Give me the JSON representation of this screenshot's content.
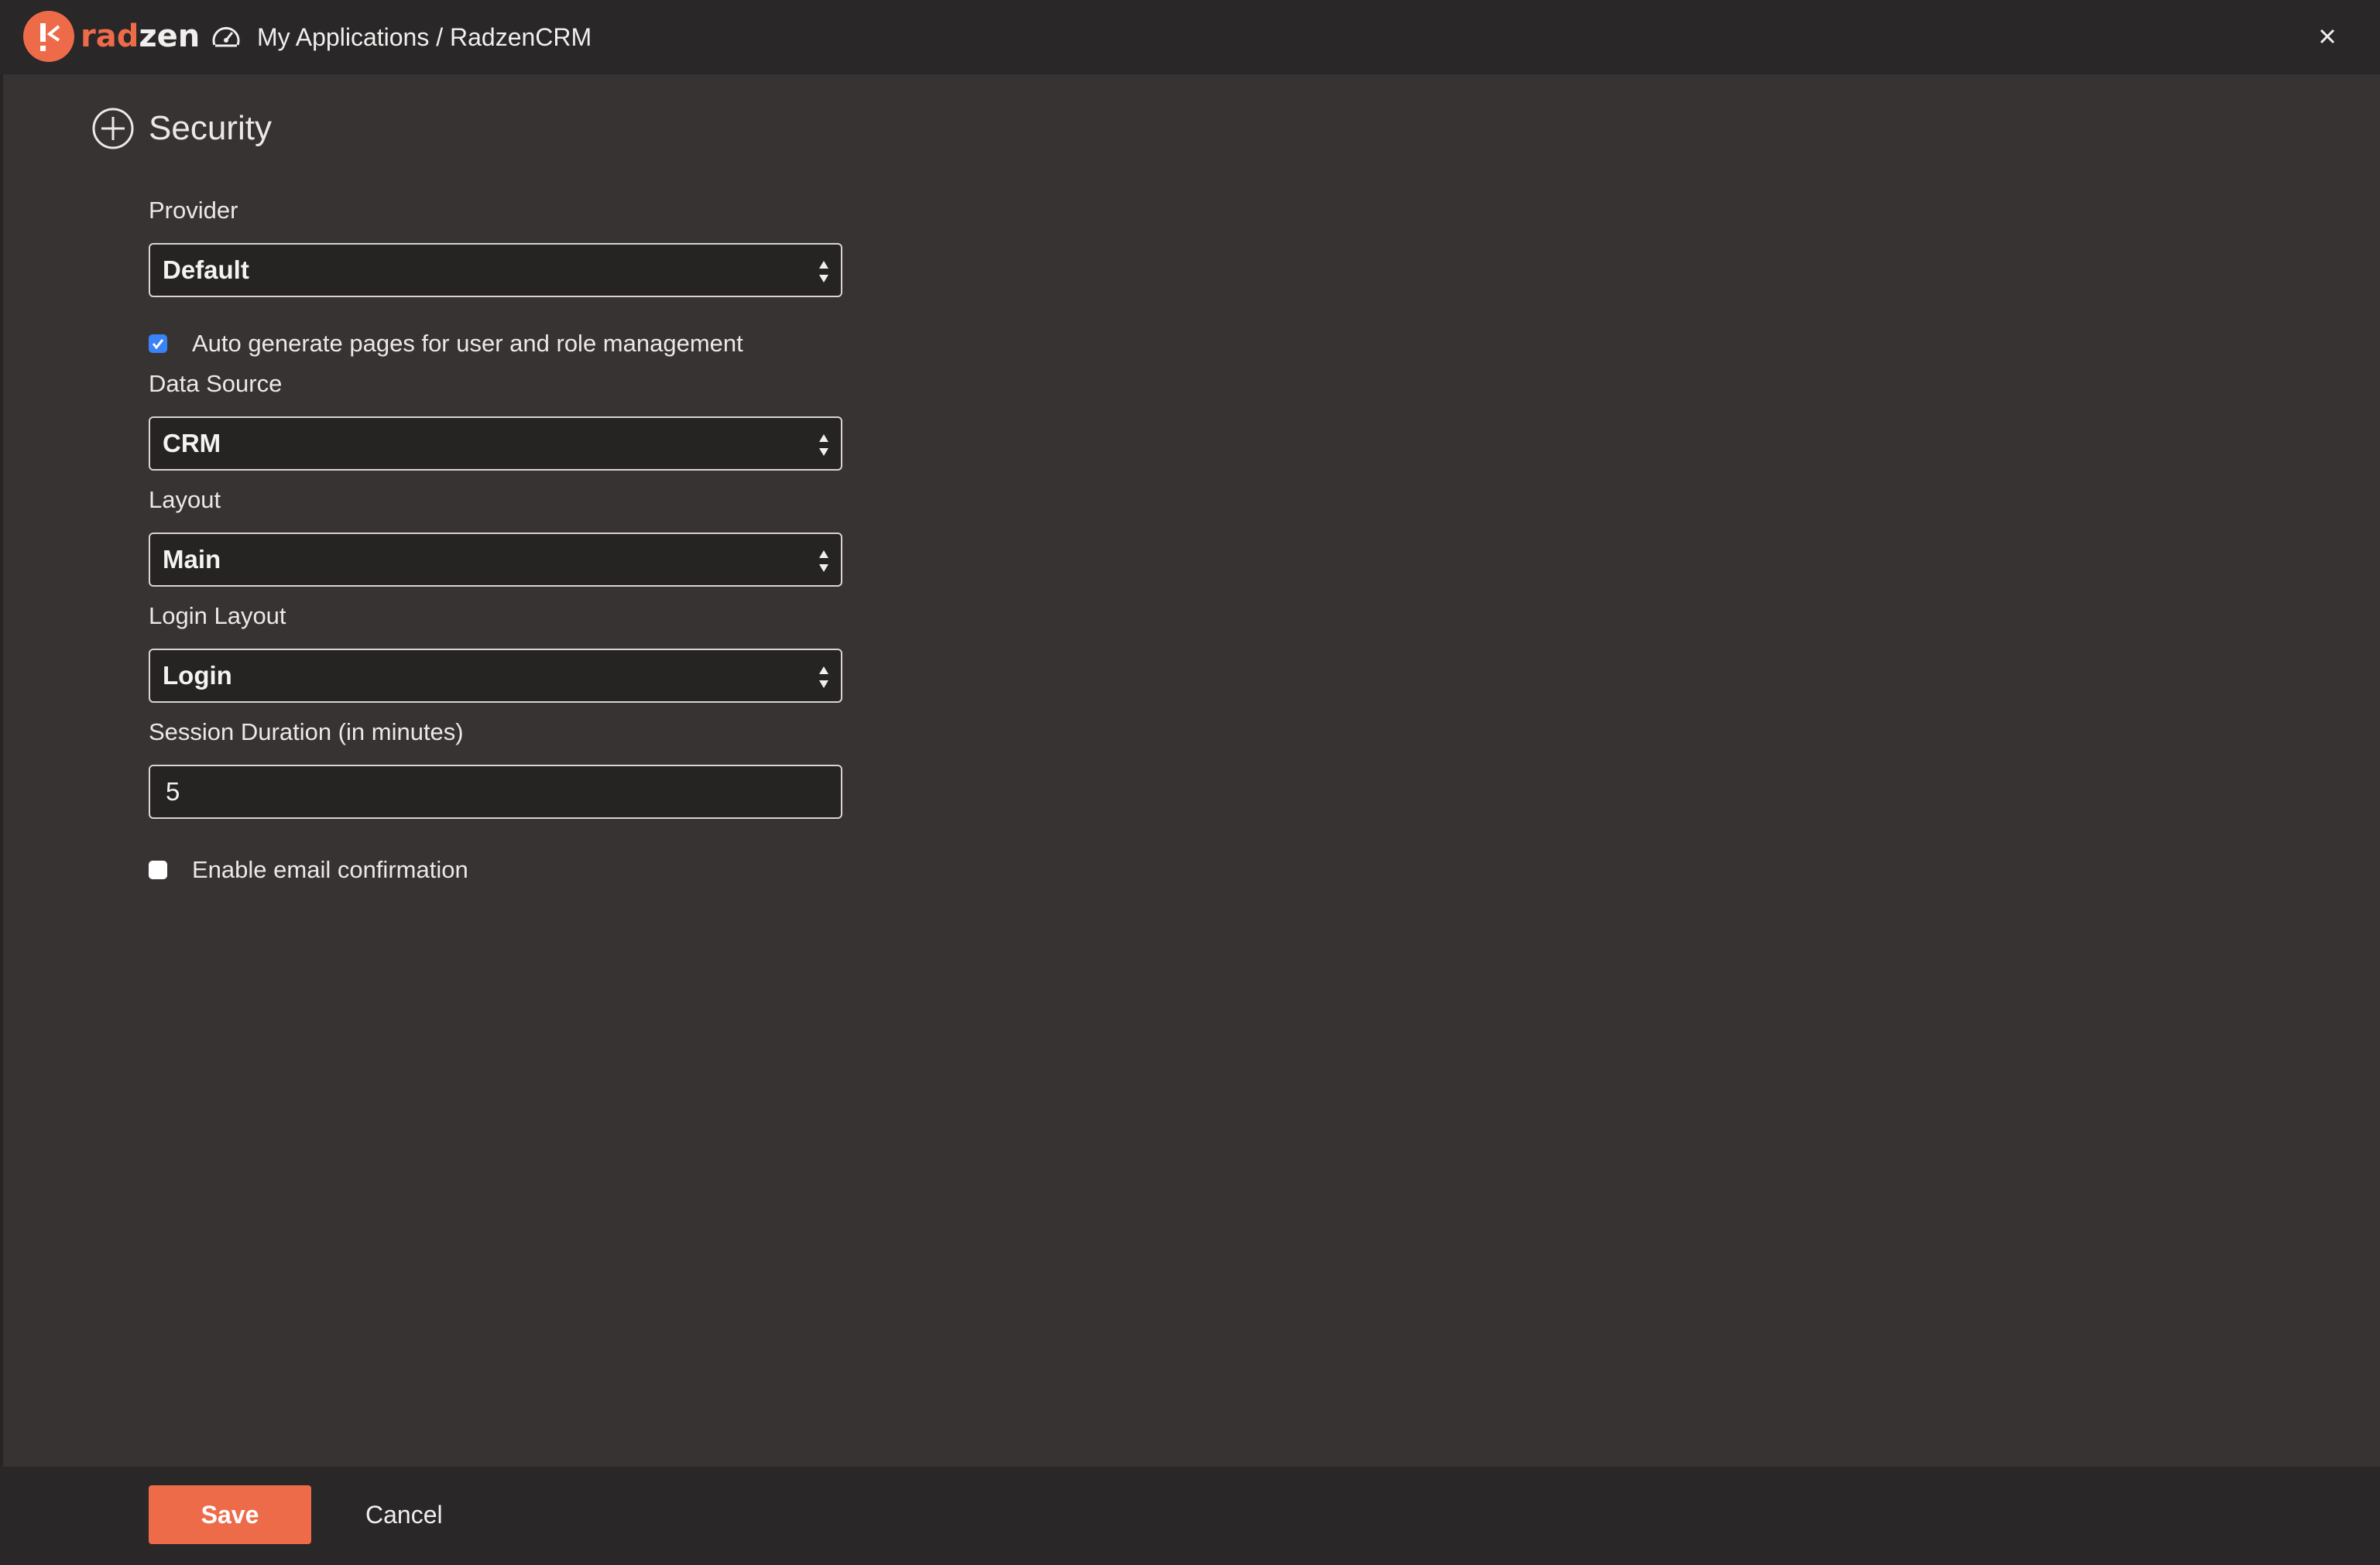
{
  "header": {
    "logo_rad": "rad",
    "logo_zen": "zen",
    "breadcrumb": "My Applications / RadzenCRM",
    "icons": {
      "logo": "radzen-logo-icon",
      "dashboard": "dashboard-gauge-icon",
      "close": "close-icon"
    }
  },
  "section": {
    "title": "Security",
    "icon": "plus-circle-icon"
  },
  "form": {
    "provider": {
      "label": "Provider",
      "value": "Default"
    },
    "auto_generate": {
      "label": "Auto generate pages for user and role management",
      "checked": true
    },
    "data_source": {
      "label": "Data Source",
      "value": "CRM"
    },
    "layout": {
      "label": "Layout",
      "value": "Main"
    },
    "login_layout": {
      "label": "Login Layout",
      "value": "Login"
    },
    "session_duration": {
      "label": "Session Duration (in minutes)",
      "value": "5"
    },
    "email_confirmation": {
      "label": "Enable email confirmation",
      "checked": false
    }
  },
  "footer": {
    "save_label": "Save",
    "cancel_label": "Cancel"
  },
  "colors": {
    "accent": "#ee6b4a",
    "background": "#383333",
    "topbar": "#292727",
    "checkbox_on": "#3a82f7"
  }
}
